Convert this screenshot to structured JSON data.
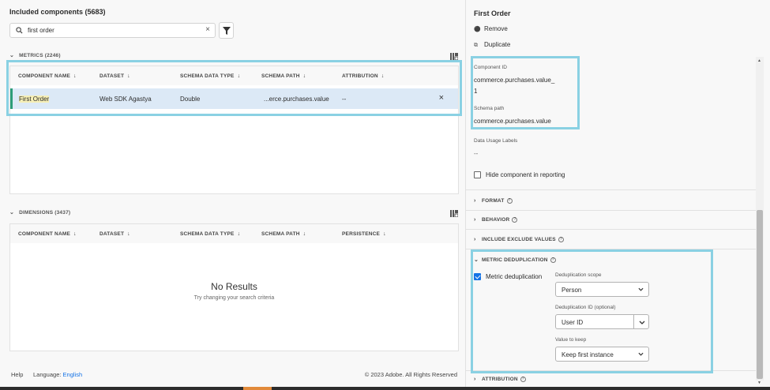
{
  "left": {
    "title": "Included components (5683)",
    "search": {
      "value": "first order",
      "clear": "×"
    },
    "metrics": {
      "heading": "METRICS (2246)",
      "columns": [
        "COMPONENT NAME",
        "DATASET",
        "SCHEMA DATA TYPE",
        "SCHEMA PATH",
        "ATTRIBUTION"
      ],
      "row": {
        "name": "First Order",
        "dataset": "Web SDK Agastya",
        "type": "Double",
        "path": "...erce.purchases.value",
        "attribution": "--",
        "remove": "×"
      }
    },
    "dimensions": {
      "heading": "DIMENSIONS (3437)",
      "columns": [
        "COMPONENT NAME",
        "DATASET",
        "SCHEMA DATA TYPE",
        "SCHEMA PATH",
        "PERSISTENCE"
      ],
      "empty_title": "No Results",
      "empty_sub": "Try changing your search criteria"
    },
    "footer": {
      "help": "Help",
      "language_label": "Language:",
      "language": "English",
      "copyright": "© 2023 Adobe. All Rights Reserved"
    }
  },
  "right": {
    "title": "First Order",
    "remove": "Remove",
    "duplicate": "Duplicate",
    "component_id_label": "Component ID",
    "component_id_line1": "commerce.purchases.value_",
    "component_id_line2": "1",
    "schema_path_label": "Schema path",
    "schema_path": "commerce.purchases.value",
    "data_usage_label": "Data Usage Labels",
    "data_usage_value": "--",
    "hide_label": "Hide component in reporting",
    "sections": {
      "format": "FORMAT",
      "behavior": "BEHAVIOR",
      "include_exclude": "INCLUDE EXCLUDE VALUES",
      "metric_dedup": "METRIC DEDUPLICATION",
      "attribution": "ATTRIBUTION"
    },
    "dedup": {
      "checkbox_label": "Metric deduplication",
      "checked": true,
      "scope_label": "Deduplication scope",
      "scope_value": "Person",
      "id_label": "Deduplication ID (optional)",
      "id_value": "User ID",
      "keep_label": "Value to keep",
      "keep_value": "Keep first instance"
    }
  },
  "colors": {
    "accent": "#1473e6",
    "highlight_box": "#8ad1e3",
    "selected_row": "#dce9f6",
    "row_bar": "#2d9d78"
  }
}
